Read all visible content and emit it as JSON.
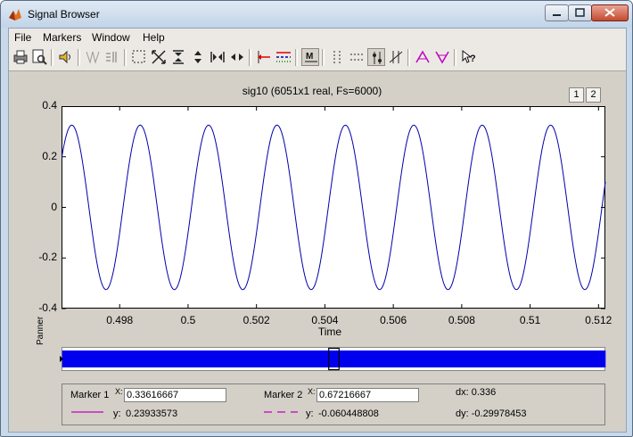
{
  "window": {
    "title": "Signal Browser"
  },
  "menu": [
    "File",
    "Markers",
    "Window",
    "Help"
  ],
  "toolbar_icons": [
    "print-icon",
    "print-preview-icon",
    "play-sound-icon",
    "select-trace-icon",
    "array-signals-icon",
    "zoom-box-icon",
    "full-view-icon",
    "zoom-in-y-icon",
    "zoom-out-y-icon",
    "zoom-in-x-icon",
    "zoom-out-x-icon",
    "peaks-select-icon",
    "line-style-icon",
    "marker-mode-icon",
    "vertical-markers-icon",
    "horizontal-markers-icon",
    "track-markers-icon",
    "slope-markers-icon",
    "peaks-icon",
    "valleys-icon",
    "whats-this-icon"
  ],
  "plot": {
    "title": "sig10 (6051x1 real, Fs=6000)",
    "page_buttons": [
      "1",
      "2"
    ],
    "xlabel": "Time",
    "panner_label": "Panner"
  },
  "chart_data": {
    "type": "line",
    "title": "sig10 (6051x1 real, Fs=6000)",
    "xlabel": "Time",
    "ylabel": "",
    "xlim": [
      0.4963,
      0.5122
    ],
    "ylim": [
      -0.4,
      0.4
    ],
    "xticks": [
      0.498,
      0.5,
      0.502,
      0.504,
      0.506,
      0.508,
      0.51,
      0.512
    ],
    "xtick_labels": [
      "0.498",
      "0.5",
      "0.502",
      "0.504",
      "0.506",
      "0.508",
      "0.51",
      "0.512"
    ],
    "yticks": [
      0.4,
      0.2,
      0,
      -0.2,
      -0.4
    ],
    "ytick_labels": [
      "0.4",
      "0.2",
      "0",
      "-0.2",
      "-0.4"
    ],
    "series": [
      {
        "color": "#0000aa",
        "model": {
          "amplitude": 0.325,
          "period": 0.002,
          "peak_times": [
            0.4966,
            0.4986,
            0.5006,
            0.5026,
            0.5046,
            0.5066,
            0.5086,
            0.5106
          ]
        }
      }
    ],
    "panner": {
      "x_range": [
        0,
        1.0085
      ],
      "view_window": [
        0.4963,
        0.5122
      ],
      "color": "#0000ee"
    }
  },
  "markers": {
    "marker1": {
      "label": "Marker 1",
      "x_label": "X:",
      "x_value": "0.33616667",
      "y_label": "y:",
      "y_value": "0.23933573",
      "line_color": "#c000c0"
    },
    "marker2": {
      "label": "Marker 2",
      "x_label": "X:",
      "x_value": "0.67216667",
      "y_label": "y:",
      "y_value": "-0.060448808",
      "line_color": "#c000c0"
    },
    "dx": "dx: 0.336",
    "dy": "dy: -0.29978453"
  }
}
